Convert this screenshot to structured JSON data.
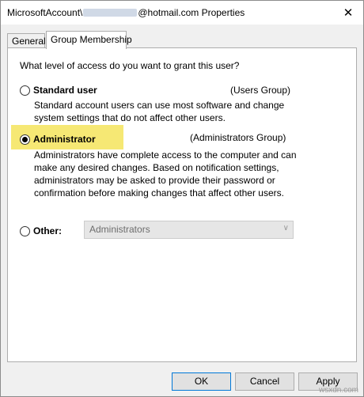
{
  "window": {
    "title_prefix": "MicrosoftAccount\\",
    "title_suffix": "@hotmail.com Properties",
    "close_glyph": "✕"
  },
  "tabs": [
    {
      "label": "General",
      "selected": false
    },
    {
      "label": "Group Membership",
      "selected": true
    }
  ],
  "panel": {
    "question": "What level of access do you want to grant this user?",
    "options": {
      "standard": {
        "label": "Standard user",
        "group": "(Users Group)",
        "description": "Standard account users can use most software and change system settings that do not affect other users.",
        "checked": false
      },
      "administrator": {
        "label": "Administrator",
        "group": "(Administrators Group)",
        "description": "Administrators have complete access to the computer and can make any desired changes. Based on notification settings, administrators may be asked to provide their password or confirmation before making changes that affect other users.",
        "checked": true
      },
      "other": {
        "label": "Other:",
        "select_value": "Administrators",
        "checked": false
      }
    }
  },
  "buttons": {
    "ok": "OK",
    "cancel": "Cancel",
    "apply": "Apply"
  },
  "watermark": "wsxdn.com",
  "colors": {
    "highlight": "#f6e874",
    "accent": "#0078d7"
  }
}
